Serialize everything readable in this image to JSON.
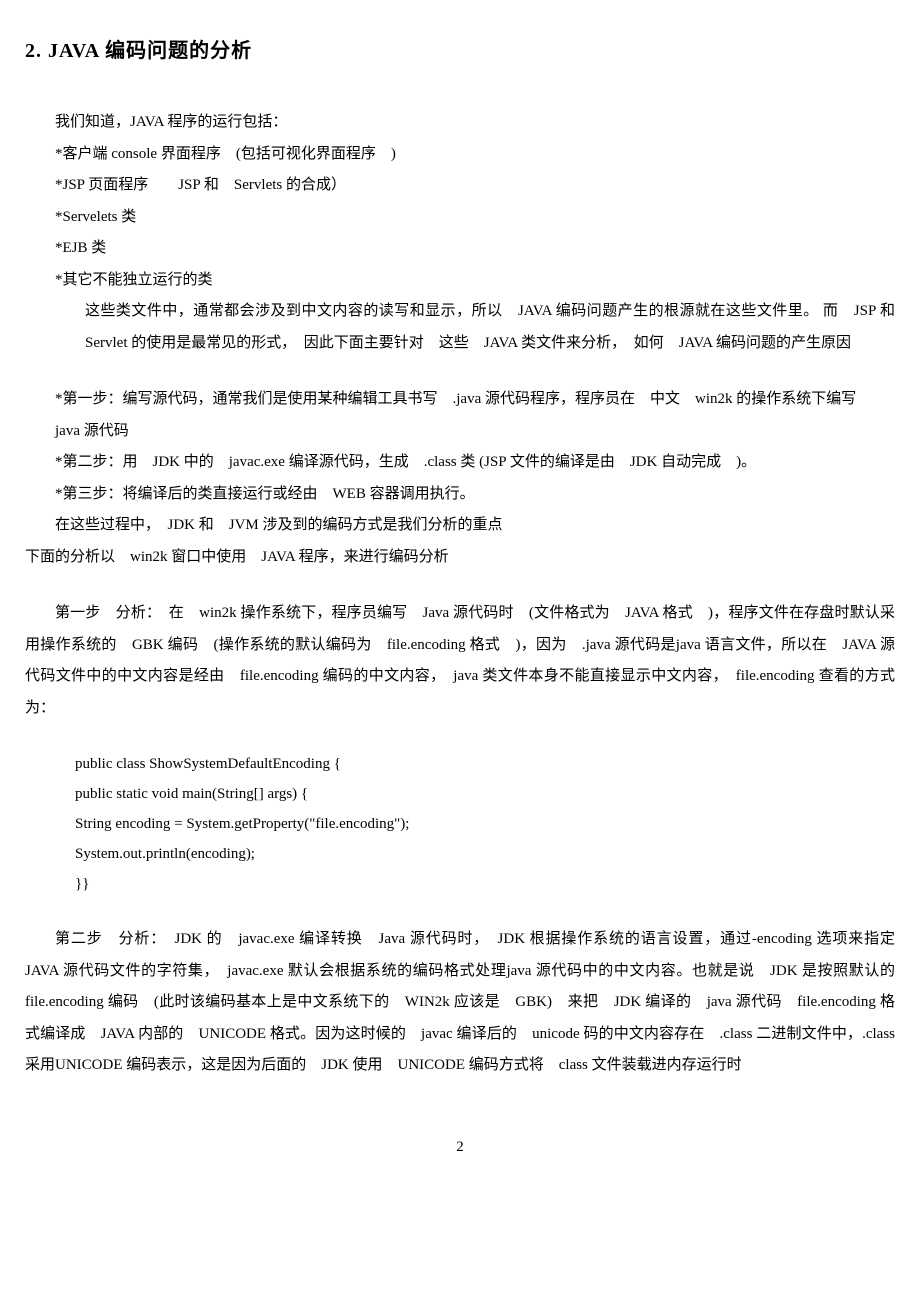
{
  "heading": "2. JAVA 编码问题的分析",
  "intro": "我们知道，JAVA 程序的运行包括：",
  "list1": "*客户端 console 界面程序　(包括可视化界面程序　)",
  "list2": "*JSP 页面程序　　JSP 和　Servlets 的合成）",
  "list3": "*Servelets 类",
  "list4": "*EJB 类",
  "list5": "*其它不能独立运行的类",
  "para1": "这些类文件中，通常都会涉及到中文内容的读写和显示，所以　JAVA 编码问题产生的根源就在这些文件里。 而　JSP 和　Servlet 的使用是最常见的形式，　因此下面主要针对　这些　JAVA 类文件来分析，　如何　JAVA 编码问题的产生原因",
  "list6": "*第一步：编写源代码，通常我们是使用某种编辑工具书写　.java 源代码程序，程序员在　中文　win2k 的操作系统下编写　java 源代码",
  "list7": "*第二步：用　JDK 中的　javac.exe 编译源代码，生成　.class 类  (JSP 文件的编译是由　JDK 自动完成　)。",
  "list8": "*第三步：将编译后的类直接运行或经由　WEB 容器调用执行。",
  "para2": "在这些过程中，　JDK 和　JVM 涉及到的编码方式是我们分析的重点",
  "para3": "下面的分析以　win2k 窗口中使用　JAVA 程序，来进行编码分析",
  "para4": "第一步　分析：　在　win2k 操作系统下，程序员编写　Java 源代码时　(文件格式为　JAVA 格式　)，程序文件在存盘时默认采用操作系统的　GBK 编码　(操作系统的默认编码为　file.encoding 格式　)，因为　.java 源代码是java 语言文件，所以在　JAVA 源代码文件中的中文内容是经由　file.encoding 编码的中文内容，　java 类文件本身不能直接显示中文内容，　file.encoding 查看的方式为：",
  "code1": "public class ShowSystemDefaultEncoding {",
  "code2": "public static void main(String[] args) {",
  "code3": "String encoding = System.getProperty(\"file.encoding\");",
  "code4": "System.out.println(encoding);",
  "code5": "}}",
  "para5": "第二步　分析：　JDK 的　javac.exe 编译转换　Java 源代码时，　JDK 根据操作系统的语言设置，通过-encoding 选项来指定　JAVA 源代码文件的字符集，　javac.exe 默认会根据系统的编码格式处理java 源代码中的中文内容。也就是说　JDK 是按照默认的　file.encoding 编码　(此时该编码基本上是中文系统下的　WIN2k 应该是　GBK)　来把　JDK 编译的　java 源代码　file.encoding 格式编译成　JAVA 内部的　UNICODE 格式。因为这时候的　javac 编译后的　unicode 码的中文内容存在　.class 二进制文件中，.class 采用UNICODE 编码表示，这是因为后面的　JDK 使用　UNICODE 编码方式将　class 文件装载进内存运行时",
  "pageNum": "2"
}
